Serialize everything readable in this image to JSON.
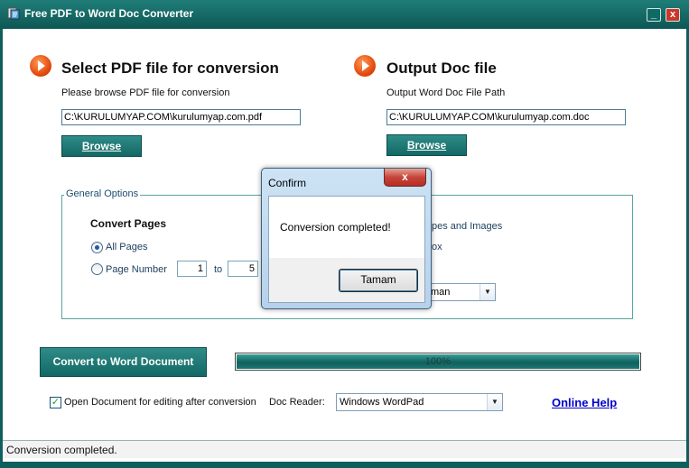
{
  "window": {
    "title": "Free PDF to Word Doc Converter",
    "minimize_label": "_",
    "close_label": "x"
  },
  "input_section": {
    "heading": "Select PDF file for conversion",
    "sublabel": "Please browse PDF file for conversion",
    "path_value": "C:\\KURULUMYAP.COM\\kurulumyap.com.pdf",
    "browse_label": "Browse"
  },
  "output_section": {
    "heading": "Output Doc file",
    "sublabel": "Output Word Doc File Path",
    "path_value": "C:\\KURULUMYAP.COM\\kurulumyap.com.doc",
    "browse_label": "Browse"
  },
  "general_options": {
    "legend": "General Options",
    "convert_pages_title": "Convert Pages",
    "all_pages_label": "All Pages",
    "all_pages_selected": true,
    "page_number_label": "Page Number",
    "page_from": "1",
    "to_label": "to",
    "page_to": "5",
    "partial_option_1": "pes and Images",
    "partial_option_2": "ox",
    "partial_combo_value": "man"
  },
  "convert_button_label": "Convert to Word Document",
  "progress": {
    "value": 100,
    "text": "100%"
  },
  "open_doc": {
    "checked": true,
    "check_mark": "✓",
    "label": "Open Document for editing after conversion"
  },
  "doc_reader": {
    "label": "Doc Reader:",
    "value": "Windows WordPad"
  },
  "help_link": "Online Help",
  "status_bar": {
    "text": "Conversion completed."
  },
  "dialog": {
    "title": "Confirm",
    "message": "Conversion completed!",
    "ok_label": "Tamam",
    "close_label": "x"
  },
  "colors": {
    "frame_teal": "#0f5f5c",
    "button_teal": "#136864",
    "link_blue": "#0000cc",
    "close_red": "#c7443b"
  }
}
